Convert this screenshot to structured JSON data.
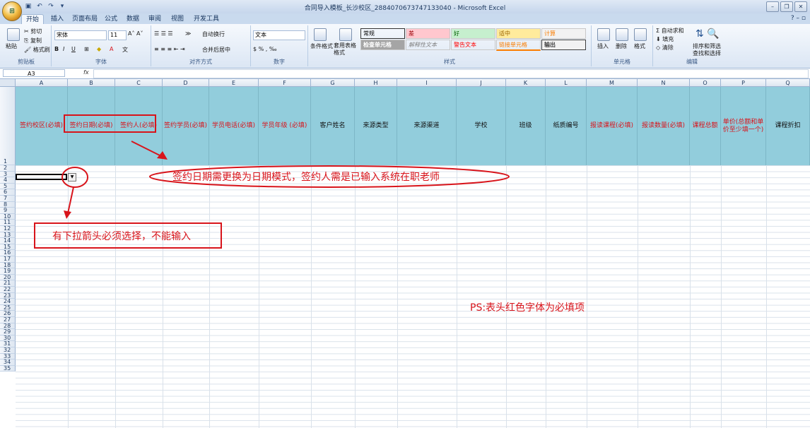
{
  "window": {
    "title": "合同导入模板_长沙校区_2884070673747133040 - Microsoft Excel"
  },
  "office_button": {
    "label": "⊞"
  },
  "tabs": [
    "开始",
    "插入",
    "页面布局",
    "公式",
    "数据",
    "审阅",
    "视图",
    "开发工具"
  ],
  "ribbon": {
    "clipboard": {
      "paste": "粘贴",
      "cut": "剪切",
      "copy": "复制",
      "format_painter": "格式刷",
      "label": "剪贴板"
    },
    "font": {
      "name": "宋体",
      "size": "11",
      "label": "字体"
    },
    "alignment": {
      "wrap": "自动换行",
      "merge": "合并后居中",
      "label": "对齐方式"
    },
    "number": {
      "format": "文本",
      "label": "数字"
    },
    "styles": {
      "cond_format": "条件格式",
      "table_format": "套用表格格式",
      "label": "样式",
      "cells": [
        {
          "text": "常规",
          "bg": "#ffffff",
          "color": "#000000"
        },
        {
          "text": "差",
          "bg": "#ffc7ce",
          "color": "#9c0006"
        },
        {
          "text": "好",
          "bg": "#c6efce",
          "color": "#006100"
        },
        {
          "text": "适中",
          "bg": "#ffeb9c",
          "color": "#9c6500"
        },
        {
          "text": "计算",
          "bg": "#f2f2f2",
          "color": "#fa7d00"
        },
        {
          "text": "检查单元格",
          "bg": "#a5a5a5",
          "color": "#ffffff"
        },
        {
          "text": "解释性文本",
          "bg": "#ffffff",
          "color": "#7f7f7f"
        },
        {
          "text": "警告文本",
          "bg": "#ffffff",
          "color": "#ff0000"
        },
        {
          "text": "链接单元格",
          "bg": "#ffffff",
          "color": "#fa7d00"
        },
        {
          "text": "输出",
          "bg": "#f2f2f2",
          "color": "#3f3f3f"
        }
      ]
    },
    "cells_group": {
      "insert": "插入",
      "delete": "删除",
      "format": "格式",
      "label": "单元格"
    },
    "editing": {
      "autosum": "自动求和",
      "fill": "填充",
      "clear": "清除",
      "sort": "排序和筛选",
      "find": "查找和选择",
      "label": "编辑"
    }
  },
  "formula_bar": {
    "name_box": "A3",
    "fx": "fx"
  },
  "columns": [
    "A",
    "B",
    "C",
    "D",
    "E",
    "F",
    "G",
    "H",
    "I",
    "J",
    "K",
    "L",
    "M",
    "N",
    "O",
    "P",
    "Q"
  ],
  "header_cells": [
    {
      "text": "签约校区(必填)",
      "required": true
    },
    {
      "text": "签约日期(必填)",
      "required": true
    },
    {
      "text": "签约人(必填)",
      "required": true
    },
    {
      "text": "签约学员(必填)",
      "required": true
    },
    {
      "text": "学员电话(必填)",
      "required": true
    },
    {
      "text": "学员年级 (必填)",
      "required": true
    },
    {
      "text": "客户姓名",
      "required": false
    },
    {
      "text": "来源类型",
      "required": false
    },
    {
      "text": "来源渠道",
      "required": false
    },
    {
      "text": "学校",
      "required": false
    },
    {
      "text": "班级",
      "required": false
    },
    {
      "text": "纸质编号",
      "required": false
    },
    {
      "text": "报读课程(必填)",
      "required": true
    },
    {
      "text": "报读数量(必填)",
      "required": true
    },
    {
      "text": "课程总额",
      "required": true
    },
    {
      "text": "单价(总额和单价至少填一个)",
      "required": true
    },
    {
      "text": "课程折扣",
      "required": false
    }
  ],
  "rows": [
    "1",
    "2",
    "3",
    "4",
    "5",
    "6",
    "7",
    "8",
    "9",
    "10",
    "11",
    "12",
    "13",
    "14",
    "15",
    "16",
    "17",
    "18",
    "19",
    "20",
    "21",
    "22",
    "23",
    "24",
    "25",
    "26",
    "27",
    "28",
    "29",
    "30",
    "31",
    "32",
    "33",
    "34",
    "35"
  ],
  "annotations": {
    "date_note": "签约日期需更换为日期模式，签约人需是已输入系统在职老师",
    "dropdown_note": "有下拉箭头必须选择，不能输入",
    "ps_note": "PS:表头红色字体为必填项"
  }
}
